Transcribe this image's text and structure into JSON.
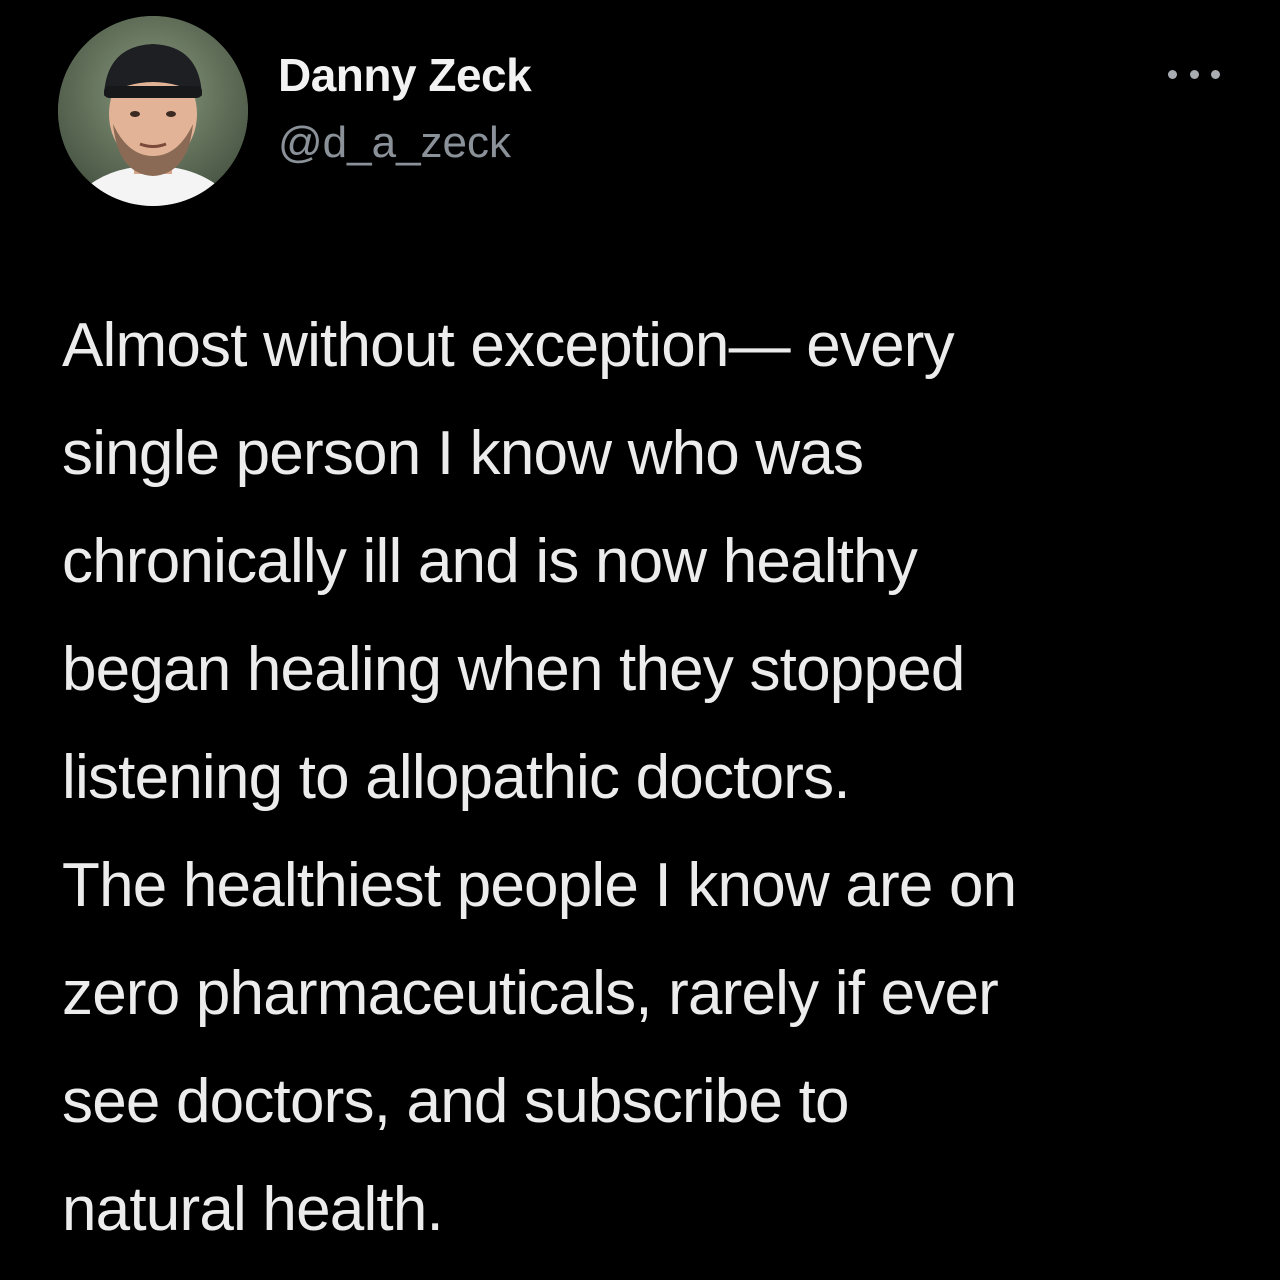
{
  "tweet": {
    "display_name": "Danny Zeck",
    "handle": "@d_a_zeck",
    "more_icon": "more-horizontal-icon",
    "paragraphs": [
      {
        "lines": [
          "Almost without exception— every",
          "single person I know who was",
          "chronically ill and is now healthy",
          "began healing when they stopped",
          "listening to allopathic doctors."
        ]
      },
      {
        "lines": [
          "The healthiest people I know are on",
          "zero pharmaceuticals, rarely if ever",
          "see doctors, and subscribe to",
          "natural health."
        ]
      }
    ]
  },
  "colors": {
    "background": "#000000",
    "text_primary": "#ececec",
    "text_secondary": "#8b9198"
  }
}
